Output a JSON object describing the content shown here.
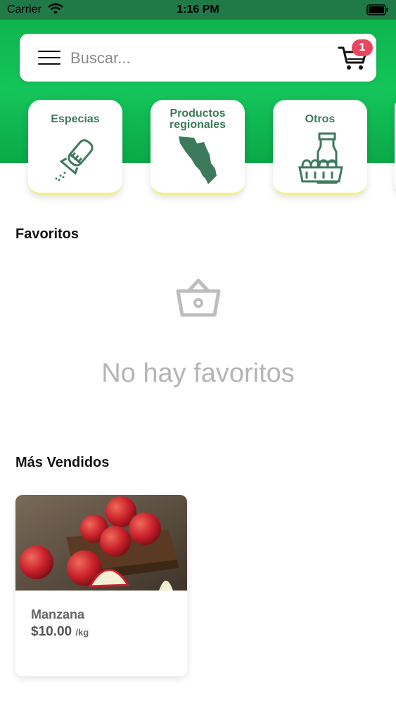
{
  "status_bar": {
    "carrier": "Carrier",
    "time": "1:16 PM"
  },
  "header": {
    "search_placeholder": "Buscar...",
    "cart_count": "1"
  },
  "categories": [
    {
      "label_line1": "Especias",
      "label_line2": "",
      "icon": "salt-shaker-icon"
    },
    {
      "label_line1": "Productos",
      "label_line2": "regionales",
      "icon": "sonora-map-icon"
    },
    {
      "label_line1": "Otros",
      "label_line2": "",
      "icon": "bottle-eggs-icon"
    }
  ],
  "favorites": {
    "title": "Favoritos",
    "empty_text": "No hay favoritos",
    "empty_icon": "basket-icon"
  },
  "best_sellers": {
    "title": "Más Vendidos",
    "products": [
      {
        "name": "Manzana",
        "price": "$10.00",
        "unit": "/kg",
        "image": "apples-photo"
      }
    ]
  },
  "colors": {
    "brand_green": "#14c55a",
    "category_text": "#3d7a5c",
    "badge": "#e8475f"
  }
}
